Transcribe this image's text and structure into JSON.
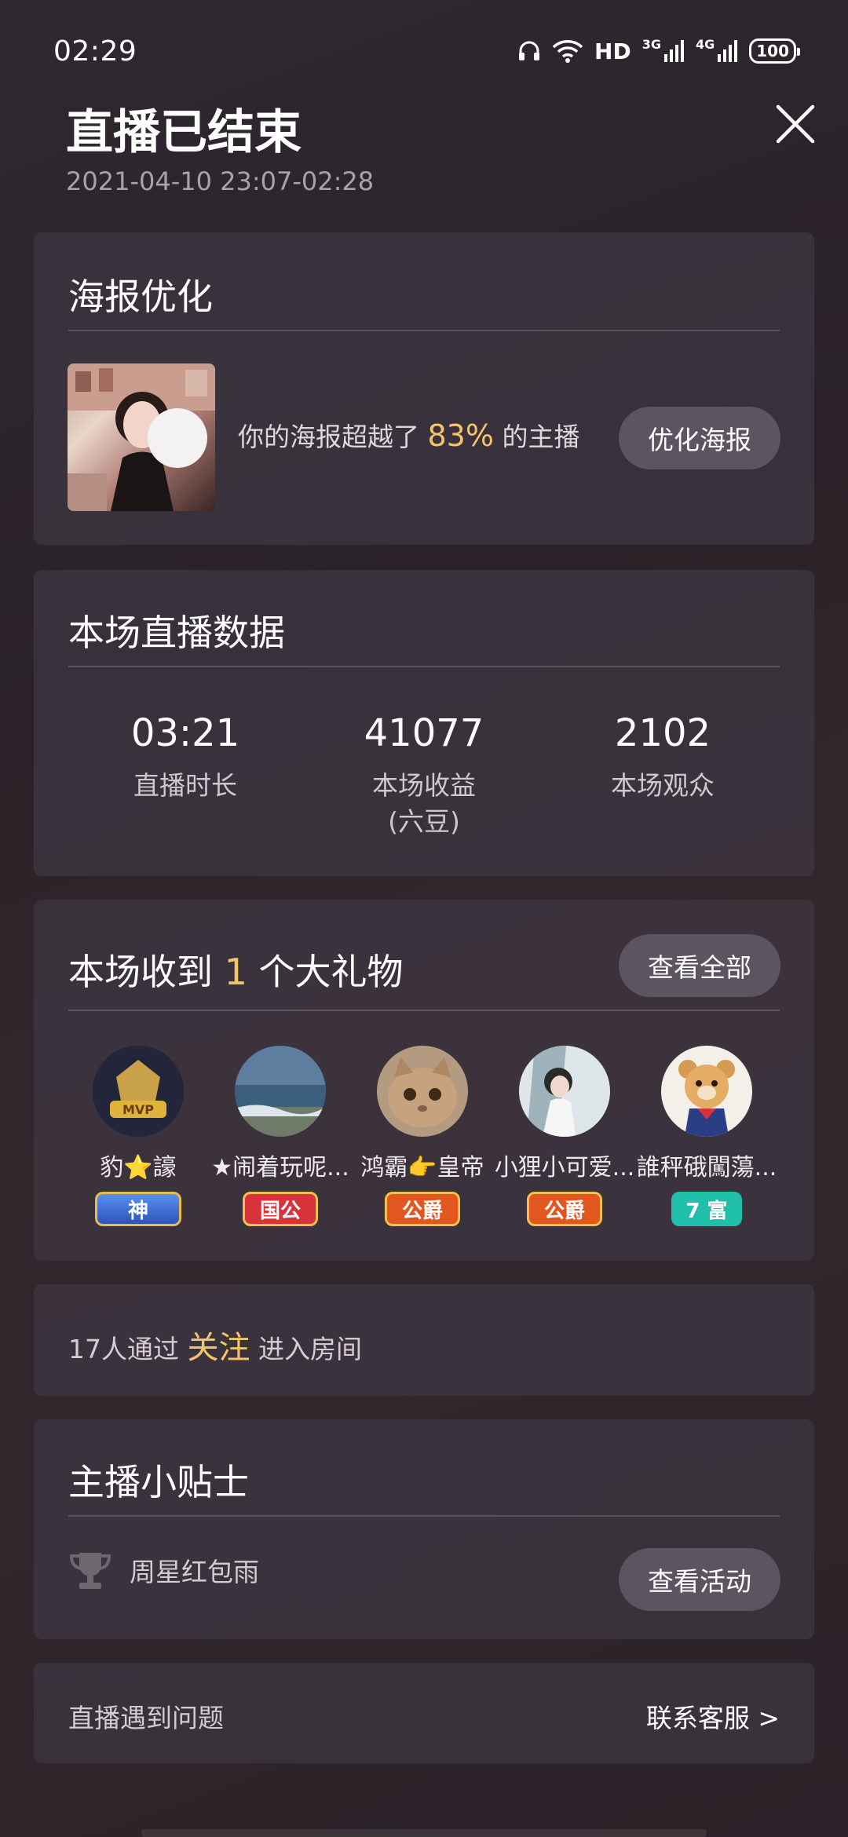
{
  "status_bar": {
    "time": "02:29",
    "hd_label": "HD",
    "network1": "3G",
    "network2": "4G",
    "battery": "100"
  },
  "header": {
    "title": "直播已结束",
    "subtitle": "2021-04-10 23:07-02:28"
  },
  "poster": {
    "title": "海报优化",
    "text_before": "你的海报超越了 ",
    "percent": "83%",
    "text_after": " 的主播",
    "button": "优化海报"
  },
  "stats": {
    "title": "本场直播数据",
    "items": [
      {
        "value": "03:21",
        "label": "直播时长",
        "label2": ""
      },
      {
        "value": "41077",
        "label": "本场收益",
        "label2": "(六豆)"
      },
      {
        "value": "2102",
        "label": "本场观众",
        "label2": ""
      }
    ]
  },
  "gifts": {
    "title_before": "本场收到 ",
    "count": "1",
    "title_after": " 个大礼物",
    "button": "查看全部",
    "donors": [
      {
        "name": "豹⭐譹",
        "badge": "神",
        "badge_color": "#3b6fd1"
      },
      {
        "name": "★闹着玩呢...",
        "badge": "国公",
        "badge_color": "#d8323a"
      },
      {
        "name": "鸿霸👉皇帝",
        "badge": "公爵",
        "badge_color": "#e2561f"
      },
      {
        "name": "小狸小可爱...",
        "badge": "公爵",
        "badge_color": "#e2561f"
      },
      {
        "name": "誰秤硪闖蕩...",
        "badge": "7 富",
        "badge_color": "#1fbfaa"
      }
    ]
  },
  "follow": {
    "text_before": "17人通过 ",
    "highlight": "关注",
    "text_after": " 进入房间"
  },
  "tips": {
    "title": "主播小贴士",
    "item": "周星红包雨",
    "button": "查看活动"
  },
  "help": {
    "left": "直播遇到问题",
    "right": "联系客服 >"
  },
  "colors": {
    "accent": "#f3c46b",
    "card": "#3e3742",
    "button": "#5c5461"
  }
}
